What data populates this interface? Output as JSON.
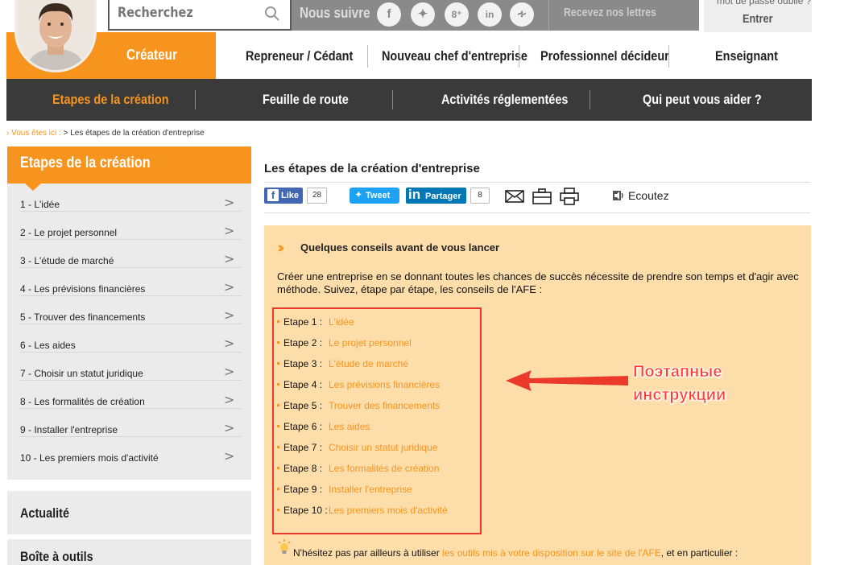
{
  "colors": {
    "accent": "#f7941d",
    "dark_menu": "#3a3a3a",
    "panel_bg": "#fddeaa",
    "annotation": "#ff3b2f"
  },
  "header": {
    "search_placeholder": "Recherchez",
    "follow_label": "Nous suivre",
    "social_icons": [
      "facebook-icon",
      "twitter-icon",
      "google-plus-icon",
      "linkedin-icon",
      "rss-icon"
    ],
    "newsletter_label": "Recevez nos lettres",
    "forgot_password": "mot de passe oublié ?",
    "login_label": "Entrer"
  },
  "roles": {
    "active": "Créateur",
    "items": [
      "Repreneur / Cédant",
      "Nouveau chef d'entreprise",
      "Professionnel décideur",
      "Enseignant"
    ]
  },
  "menu": {
    "items": [
      "Etapes de la création",
      "Feuille de route",
      "Activités réglementées",
      "Qui peut vous aider ?"
    ]
  },
  "breadcrumb": {
    "prefix": "› Vous êtes ici :",
    "path": " > Les étapes de la création d'entreprise"
  },
  "sidebar": {
    "title": "Etapes de la création",
    "items": [
      "1 - L'idée",
      "2 - Le projet personnel",
      "3 - L'étude de marché",
      "4 - Les prévisions financières",
      "5 - Trouver des financements",
      "6 - Les aides",
      "7 - Choisir un statut juridique",
      "8 - Les formalités de création",
      "9 - Installer l'entreprise",
      "10 - Les premiers mois d'activité"
    ],
    "blocks": [
      "Actualité",
      "Boîte à outils"
    ]
  },
  "main": {
    "title": "Les étapes de la création d'entreprise",
    "share": {
      "fb_label": "Like",
      "fb_count": "28",
      "tw_label": "Tweet",
      "li_label": "Partager",
      "li_count": "8",
      "listen_label": "Ecoutez"
    },
    "panel": {
      "heading": "Quelques conseils avant de vous lancer",
      "intro": "Créer une entreprise en se donnant toutes les chances de succès nécessite de prendre son temps et d'agir avec méthode. Suivez, étape par étape, les conseils de l'AFE :",
      "steps": [
        {
          "num": "Etape 1 :",
          "label": "L'idée"
        },
        {
          "num": "Etape 2 :",
          "label": "Le projet personnel"
        },
        {
          "num": "Etape 3 :",
          "label": "L'étude de marché"
        },
        {
          "num": "Etape 4 :",
          "label": "Les prévisions financières"
        },
        {
          "num": "Etape 5 :",
          "label": "Trouver des financements"
        },
        {
          "num": "Etape 6 :",
          "label": "Les aides"
        },
        {
          "num": "Etape 7 :",
          "label": "Choisir un statut juridique"
        },
        {
          "num": "Etape 8 :",
          "label": "Les formalités de création"
        },
        {
          "num": "Etape 9 :",
          "label": "Installer l'entreprise"
        },
        {
          "num": "Etape 10 :",
          "label": "Les premiers mois d'activité"
        }
      ],
      "tip_before": "N'hésitez pas par ailleurs à utiliser ",
      "tip_link": "les outils mis à votre disposition sur le site de l'AFE",
      "tip_after": ", et en particulier :"
    }
  },
  "annotation": {
    "line1": "Поэтапные",
    "line2": "инструкции"
  }
}
